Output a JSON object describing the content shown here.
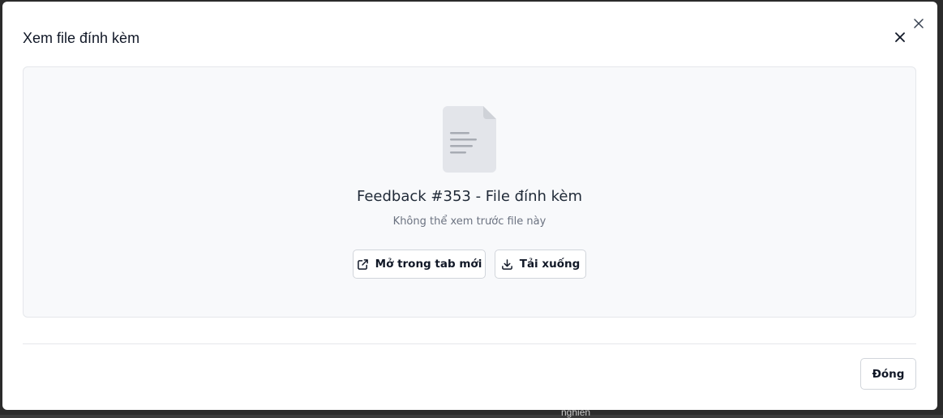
{
  "dialog": {
    "title": "Xem file đính kèm",
    "close_icon": "close-icon"
  },
  "preview": {
    "file_icon": "document-icon",
    "file_name": "Feedback #353 - File đính kèm",
    "message": "Không thể xem trước file này",
    "open_new_tab_label": "Mở trong tab mới",
    "open_new_tab_icon": "external-link-icon",
    "download_label": "Tải xuống",
    "download_icon": "download-icon"
  },
  "footer": {
    "close_label": "Đóng"
  },
  "background": {
    "partial_text": "nghien"
  },
  "colors": {
    "panel_bg": "#f8f9fb",
    "border": "#d1d5db",
    "text_primary": "#111827",
    "text_muted": "#6b7280",
    "file_icon_fill": "#e3e5ea"
  }
}
